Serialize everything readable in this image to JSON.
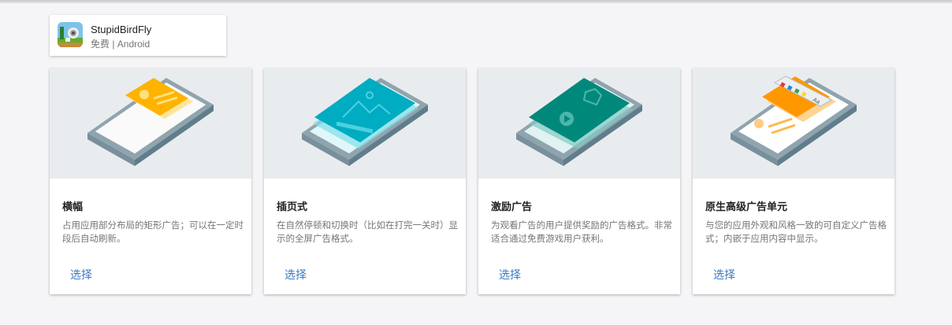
{
  "app": {
    "name": "StupidBirdFly",
    "meta": "免费 | Android",
    "icon": "stupid-bird-fly-app-icon"
  },
  "colors": {
    "accent": "#3b78c4",
    "banner": "#ffb300",
    "interstitial": "#00acc1",
    "rewarded": "#00897b",
    "native": "#ff9800",
    "phone_body": "#90a4ae"
  },
  "cards": [
    {
      "title": "横幅",
      "desc": "占用应用部分布局的矩形广告；可以在一定时段后自动刷新。",
      "button": "选择",
      "illustration": "banner-phone-illustration"
    },
    {
      "title": "插页式",
      "desc": "在自然停顿和切换时（比如在打完一关时）显示的全屏广告格式。",
      "button": "选择",
      "illustration": "interstitial-phone-illustration"
    },
    {
      "title": "激励广告",
      "desc": "为观看广告的用户提供奖励的广告格式。非常适合通过免费游戏用户获利。",
      "button": "选择",
      "illustration": "rewarded-phone-illustration"
    },
    {
      "title": "原生高级广告单元",
      "desc": "与您的应用外观和风格一致的可自定义广告格式；内嵌于应用内容中显示。",
      "button": "选择",
      "illustration": "native-phone-illustration"
    }
  ]
}
